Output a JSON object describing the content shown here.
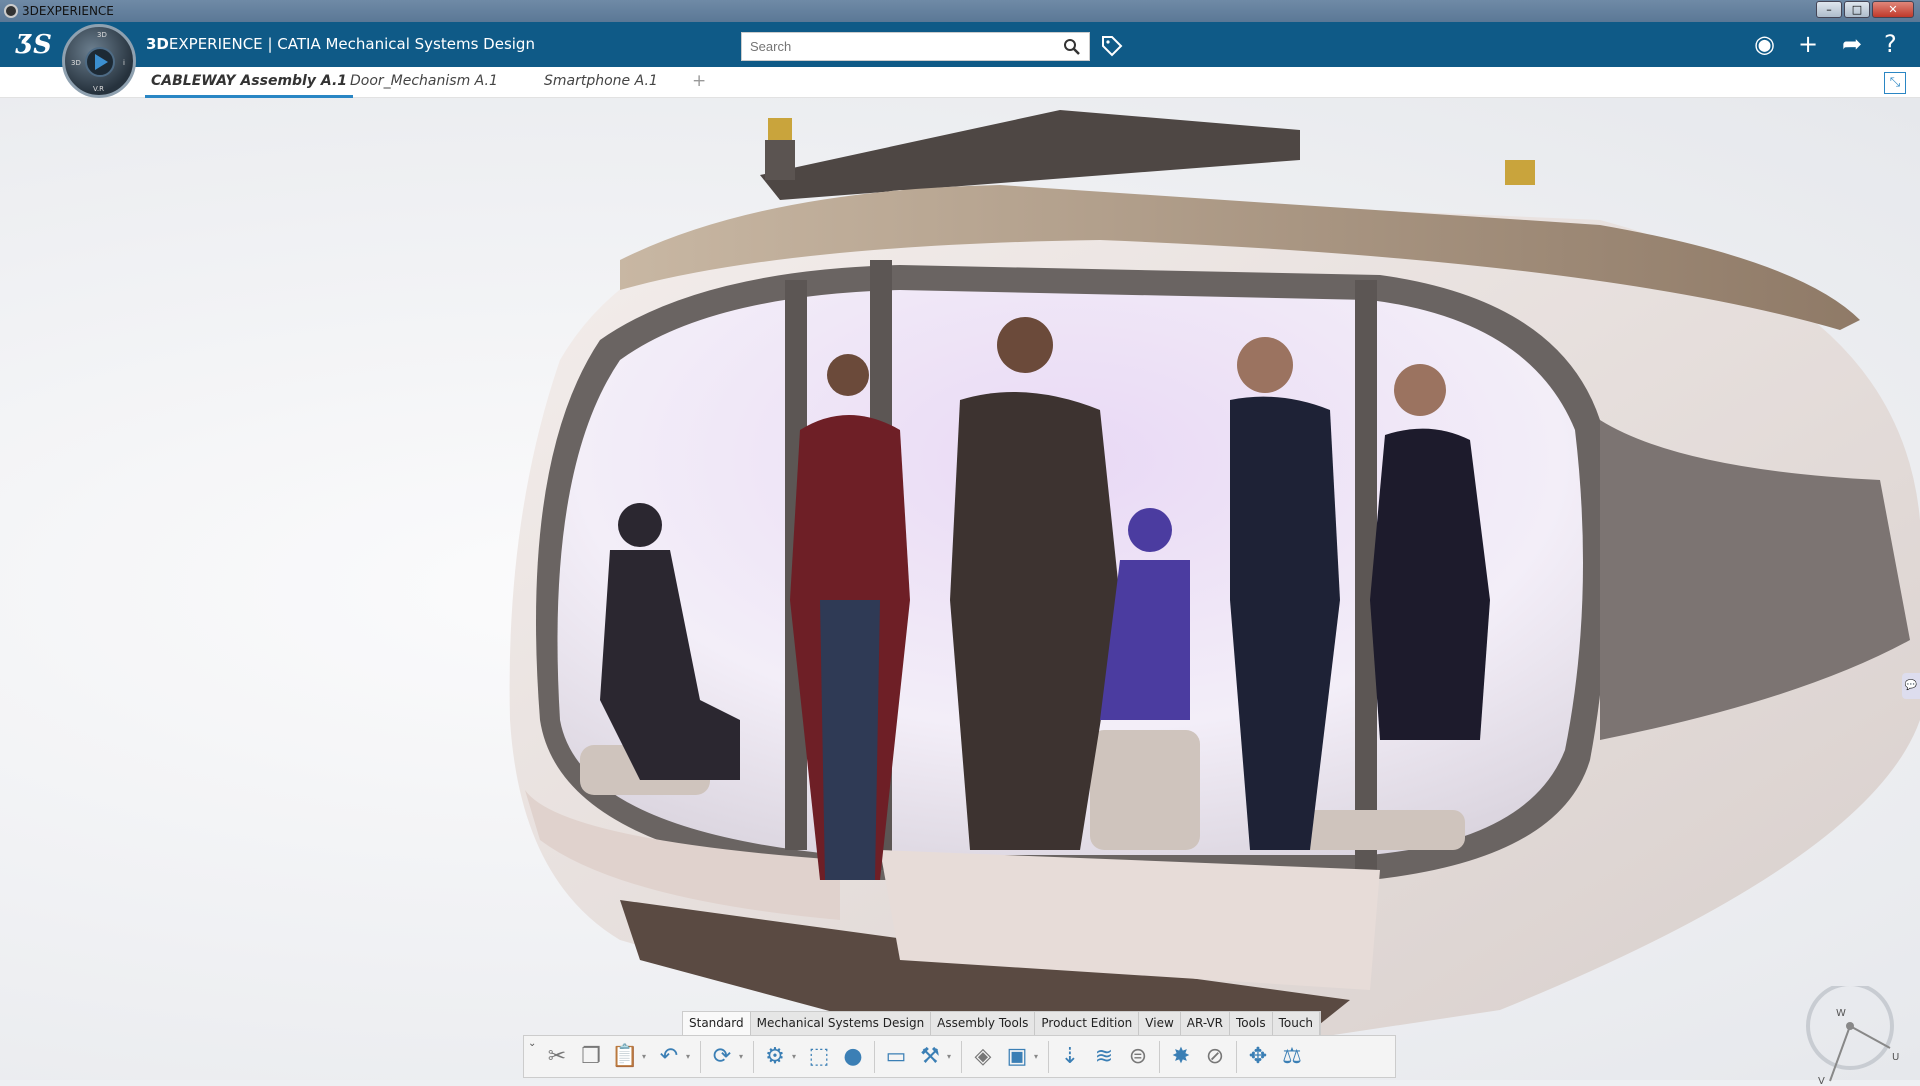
{
  "window": {
    "title": "3DEXPERIENCE",
    "controls": [
      "minimize",
      "maximize",
      "close"
    ]
  },
  "header": {
    "brand_bold": "3D",
    "brand_rest": "EXPERIENCE",
    "separator": "|",
    "app": "CATIA Mechanical Systems Design",
    "search_placeholder": "Search",
    "compass_labels": {
      "top": "3D",
      "left": "3D",
      "right": "i",
      "bottom": "V.R"
    }
  },
  "tabs": [
    {
      "label": "CABLEWAY Assembly A.1",
      "active": true
    },
    {
      "label": "Door_Mechanism A.1",
      "active": false
    },
    {
      "label": "Smartphone A.1",
      "active": false
    }
  ],
  "add_tab": "+",
  "toolbar": {
    "tabs": [
      "Standard",
      "Mechanical Systems Design",
      "Assembly Tools",
      "Product Edition",
      "View",
      "AR-VR",
      "Tools",
      "Touch"
    ],
    "active_tab": "Standard",
    "icons": [
      "cut-icon",
      "copy-icon",
      "paste-icon",
      "undo-icon",
      "update-icon",
      "engineering-connection-icon",
      "fix-icon",
      "assembly-icon",
      "mechanism-icon",
      "joint-icon",
      "product-icon",
      "component-icon",
      "drop-icon",
      "spring-icon",
      "bearing-icon",
      "clash-icon",
      "clearance-icon",
      "move-icon",
      "balance-icon"
    ]
  },
  "compass": {
    "labels": [
      "W",
      "U",
      "V"
    ]
  },
  "colors": {
    "header": "#0f5a87",
    "accent": "#2a86c4"
  }
}
